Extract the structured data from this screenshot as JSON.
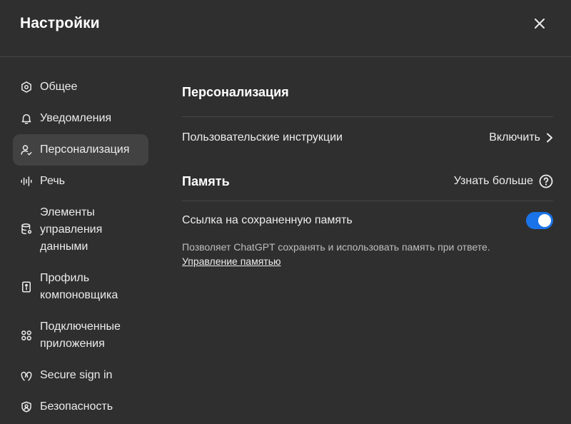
{
  "header": {
    "title": "Настройки",
    "close_icon": "close-icon"
  },
  "sidebar": {
    "items": [
      {
        "lines": [
          "Общее"
        ],
        "icon": "gear-icon"
      },
      {
        "lines": [
          "Уведомления"
        ],
        "icon": "bell-icon"
      },
      {
        "lines": [
          "Персонализация"
        ],
        "icon": "user-icon",
        "active": true
      },
      {
        "lines": [
          "Речь"
        ],
        "icon": "waveform-icon"
      },
      {
        "lines": [
          "Элементы",
          "управления",
          "данными"
        ],
        "icon": "database-icon"
      },
      {
        "lines": [
          "Профиль",
          "компоновщика"
        ],
        "icon": "id-card-icon"
      },
      {
        "lines": [
          "Подключенные",
          "приложения"
        ],
        "icon": "apps-icon"
      },
      {
        "lines": [
          "Secure sign in"
        ],
        "icon": "passkey-icon"
      },
      {
        "lines": [
          "Безопасность"
        ],
        "icon": "shield-icon"
      }
    ]
  },
  "main": {
    "title": "Персонализация",
    "custom_instructions": {
      "label": "Пользовательские инструкции",
      "action": "Включить"
    },
    "memory": {
      "title": "Память",
      "learn_more": "Узнать больше",
      "reference_label": "Ссылка на сохраненную память",
      "toggle_on": true,
      "description": "Позволяет ChatGPT сохранять и использовать память при ответе.",
      "manage_link": "Управление памятью"
    }
  },
  "colors": {
    "background": "#2f2f2f",
    "active_nav": "#424242",
    "toggle": "#1a73e8",
    "divider": "#474747"
  }
}
